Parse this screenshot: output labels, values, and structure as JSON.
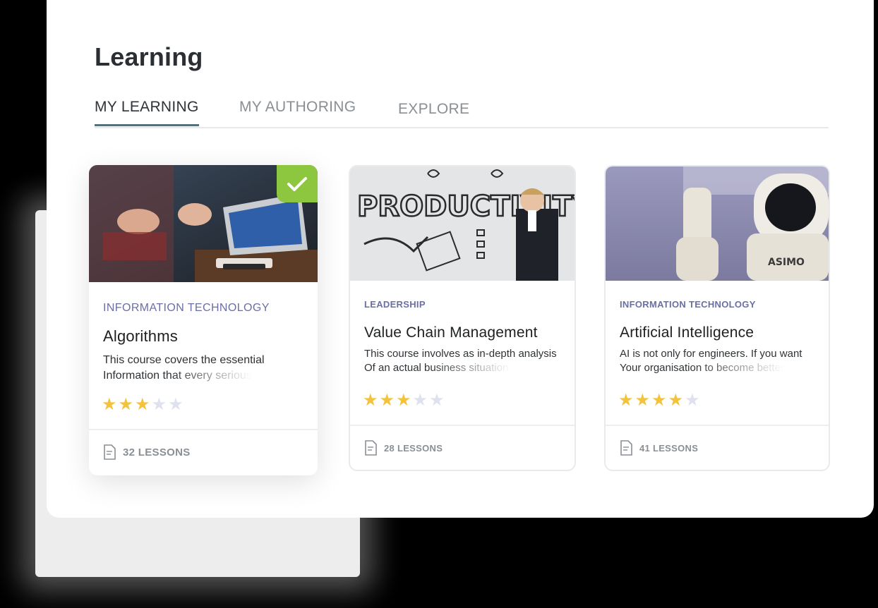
{
  "page": {
    "title": "Learning"
  },
  "tabs": [
    {
      "label": "MY LEARNING",
      "active": true
    },
    {
      "label": "MY AUTHORING",
      "active": false
    },
    {
      "label": "EXPLORE",
      "active": false
    }
  ],
  "courses": [
    {
      "category": "INFORMATION TECHNOLOGY",
      "title": "Algorithms",
      "desc_line1": "This course covers the essential",
      "desc_line2": "Information that every serious",
      "rating": 3,
      "max_rating": 5,
      "lessons": "32 LESSONS",
      "completed": true,
      "image": "laptop-meeting-photo"
    },
    {
      "category": "LEADERSHIP",
      "title": "Value Chain Management",
      "desc_line1": "This course involves as in-depth analysis",
      "desc_line2": "Of an actual business situation.",
      "rating": 3,
      "max_rating": 5,
      "lessons": "28 LESSONS",
      "completed": false,
      "image": "productivity-wall-photo",
      "image_text": "PRODUCTIVITY"
    },
    {
      "category": "INFORMATION TECHNOLOGY",
      "title": "Artificial Intelligence",
      "desc_line1": "AI is not only for engineers. If you want",
      "desc_line2": "Your organisation to become better",
      "rating": 4,
      "max_rating": 5,
      "lessons": "41 LESSONS",
      "completed": false,
      "image": "asimo-robot-photo",
      "image_text": "ASIMO"
    }
  ],
  "colors": {
    "accent_category": "#6b6fa6",
    "star_filled": "#f3c33c",
    "star_empty": "#dfe1ee",
    "completed_badge": "#8dc63f",
    "tab_underline": "#56707a"
  }
}
